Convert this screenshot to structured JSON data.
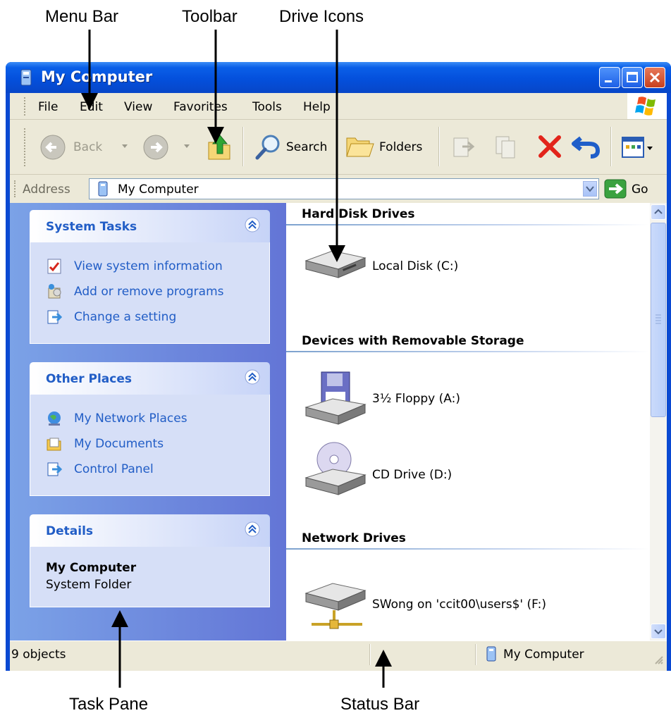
{
  "callouts": {
    "menu_bar": "Menu Bar",
    "toolbar": "Toolbar",
    "drive_icons": "Drive Icons",
    "task_pane": "Task Pane",
    "status_bar": "Status Bar"
  },
  "window": {
    "title": "My Computer",
    "buttons": [
      "minimize",
      "maximize",
      "close"
    ]
  },
  "menu": [
    "File",
    "Edit",
    "View",
    "Favorites",
    "Tools",
    "Help"
  ],
  "toolbar": {
    "back": "Back",
    "search": "Search",
    "folders": "Folders",
    "icons": [
      "back-arrow-icon",
      "forward-arrow-icon",
      "up-folder-icon",
      "search-magnifier-icon",
      "folders-icon",
      "move-to-icon",
      "copy-to-icon",
      "delete-icon",
      "undo-icon",
      "views-icon"
    ]
  },
  "address": {
    "label": "Address",
    "value": "My Computer",
    "go": "Go"
  },
  "task_pane": {
    "system_tasks": {
      "title": "System Tasks",
      "items": [
        "View system information",
        "Add or remove programs",
        "Change a setting"
      ]
    },
    "other_places": {
      "title": "Other Places",
      "items": [
        "My Network Places",
        "My Documents",
        "Control Panel"
      ]
    },
    "details": {
      "title": "Details",
      "name": "My Computer",
      "type": "System Folder"
    }
  },
  "content": {
    "hard_disk": {
      "title": "Hard Disk Drives",
      "items": [
        "Local Disk (C:)"
      ]
    },
    "removable": {
      "title": "Devices with Removable Storage",
      "items": [
        "3½ Floppy (A:)",
        "CD Drive (D:)"
      ]
    },
    "network": {
      "title": "Network Drives",
      "items": [
        "SWong on 'ccit00\\users$' (F:)"
      ]
    }
  },
  "status": {
    "objects": "9 objects",
    "location": "My Computer"
  },
  "colors": {
    "title_bar": "#0450dc",
    "task_pane": "#6375d6",
    "task_link": "#215dc6",
    "chrome": "#ece9d8"
  }
}
